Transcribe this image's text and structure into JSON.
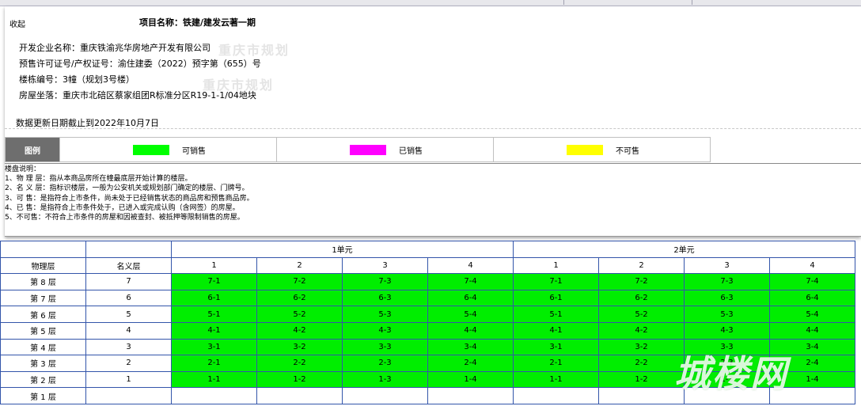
{
  "panel": {
    "collapse_label": "收起",
    "project_title": "项目名称：铁建/建发云著一期",
    "developer": "开发企业名称：重庆铁渝兆华房地产开发有限公司",
    "permit": "预售许可证号/产权证号：渝住建委（2022）预字第（655）号",
    "building": "楼栋编号：3幢（规划3号楼）",
    "location": "房屋坐落：重庆市北碚区蔡家组团R标准分区R19-1-1/04地块",
    "watermark_1": "重庆市规划",
    "watermark_2": "重庆市规划",
    "updated": "数据更新日期截止到2022年10月7日"
  },
  "legend": {
    "header": "图例",
    "items": [
      {
        "label": "可销售",
        "color": "#00ff00"
      },
      {
        "label": "已销售",
        "color": "#ff00ff"
      },
      {
        "label": "不可售",
        "color": "#ffff00"
      }
    ]
  },
  "notes": [
    "楼盘说明：",
    "1、物 理 层：指从本商品房所在幢最底层开始计算的楼层。",
    "2、名 义 层：指标识楼层，一般为公安机关或规划部门确定的楼层、门牌号。",
    "3、可 售：是指符合上市条件，尚未处于已经销售状态的商品房和预售商品房。",
    "4、已 售：是指符合上市条件处于，已进入或完成认购（含网签）的房屋。",
    "5、不可售：不符合上市条件的房屋和因被查封、被抵押等限制销售的房屋。"
  ],
  "grid": {
    "col_physical": "物理层",
    "col_nominal": "名义层",
    "units": [
      {
        "name": "1单元",
        "rooms": [
          "1",
          "2",
          "3",
          "4"
        ]
      },
      {
        "name": "2单元",
        "rooms": [
          "1",
          "2",
          "3",
          "4"
        ]
      }
    ],
    "rows": [
      {
        "physical": "第 8 层",
        "nominal": "7",
        "cells": [
          "7-1",
          "7-2",
          "7-3",
          "7-4",
          "7-1",
          "7-2",
          "7-3",
          "7-4"
        ],
        "status": "可销售"
      },
      {
        "physical": "第 7 层",
        "nominal": "6",
        "cells": [
          "6-1",
          "6-2",
          "6-3",
          "6-4",
          "6-1",
          "6-2",
          "6-3",
          "6-4"
        ],
        "status": "可销售"
      },
      {
        "physical": "第 6 层",
        "nominal": "5",
        "cells": [
          "5-1",
          "5-2",
          "5-3",
          "5-4",
          "5-1",
          "5-2",
          "5-3",
          "5-4"
        ],
        "status": "可销售"
      },
      {
        "physical": "第 5 层",
        "nominal": "4",
        "cells": [
          "4-1",
          "4-2",
          "4-3",
          "4-4",
          "4-1",
          "4-2",
          "4-3",
          "4-4"
        ],
        "status": "可销售"
      },
      {
        "physical": "第 4 层",
        "nominal": "3",
        "cells": [
          "3-1",
          "3-2",
          "3-3",
          "3-4",
          "3-1",
          "3-2",
          "3-3",
          "3-4"
        ],
        "status": "可销售"
      },
      {
        "physical": "第 3 层",
        "nominal": "2",
        "cells": [
          "2-1",
          "2-2",
          "2-3",
          "2-4",
          "2-1",
          "2-2",
          "2-3",
          "2-4"
        ],
        "status": "可销售"
      },
      {
        "physical": "第 2 层",
        "nominal": "1",
        "cells": [
          "1-1",
          "1-2",
          "1-3",
          "1-4",
          "1-1",
          "1-2",
          "1-3",
          "1-4"
        ],
        "status": "可销售"
      },
      {
        "physical": "第 1 层",
        "nominal": "",
        "cells": [
          "",
          "",
          "",
          "",
          "",
          "",
          "",
          ""
        ],
        "status": ""
      }
    ]
  },
  "site_watermark": "城楼网"
}
